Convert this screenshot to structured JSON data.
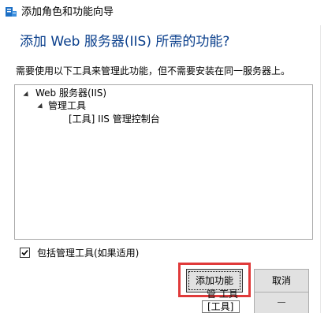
{
  "window": {
    "title": "添加角色和功能向导"
  },
  "dialog": {
    "headline": "添加 Web 服务器(IIS) 所需的功能?",
    "description": "需要使用以下工具来管理此功能，但不需要安装在同一服务器上。"
  },
  "tree": {
    "nodes": [
      {
        "label": "Web 服务器(IIS)",
        "expanded": true
      },
      {
        "label": "管理工具",
        "expanded": true
      },
      {
        "label": "[工具] IIS 管理控制台"
      }
    ]
  },
  "include_tools": {
    "checked": true,
    "label": "包括管理工具(如果适用)"
  },
  "buttons": {
    "add": "添加功能",
    "cancel": "取消"
  },
  "overlay": {
    "fragment1": "管 工具",
    "fragment2": "[工具]"
  },
  "colors": {
    "headline": "#0a3f8c",
    "highlight": "#e03a3a"
  }
}
